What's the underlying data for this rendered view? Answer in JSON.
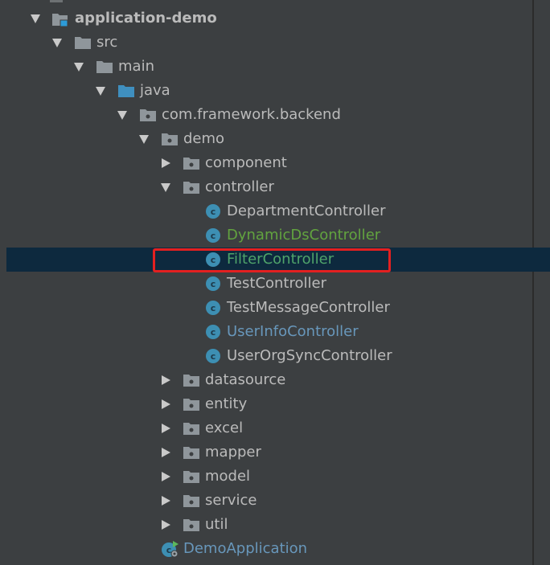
{
  "tree": {
    "root": {
      "label": "application-demo",
      "icon": "module-folder-icon",
      "expanded": true
    },
    "src": {
      "label": "src",
      "icon": "folder-icon",
      "expanded": true
    },
    "main": {
      "label": "main",
      "icon": "folder-icon",
      "expanded": true
    },
    "java": {
      "label": "java",
      "icon": "source-root-folder-icon",
      "expanded": true
    },
    "package": {
      "label": "com.framework.backend",
      "icon": "package-icon",
      "expanded": true
    },
    "demo": {
      "label": "demo",
      "icon": "package-icon",
      "expanded": true
    },
    "component": {
      "label": "component",
      "icon": "package-icon",
      "expanded": false
    },
    "controller": {
      "label": "controller",
      "icon": "package-icon",
      "expanded": true
    },
    "classes": [
      {
        "label": "DepartmentController",
        "color": "#bbbbbb"
      },
      {
        "label": "DynamicDsController",
        "color": "#62a33f"
      },
      {
        "label": "FilterController",
        "color": "#4fa36a",
        "selected": true
      },
      {
        "label": "TestController",
        "color": "#bbbbbb"
      },
      {
        "label": "TestMessageController",
        "color": "#bbbbbb"
      },
      {
        "label": "UserInfoController",
        "color": "#6897bb"
      },
      {
        "label": "UserOrgSyncController",
        "color": "#bbbbbb"
      }
    ],
    "packages_after": [
      {
        "label": "datasource"
      },
      {
        "label": "entity"
      },
      {
        "label": "excel"
      },
      {
        "label": "mapper"
      },
      {
        "label": "model"
      },
      {
        "label": "service"
      },
      {
        "label": "util"
      }
    ],
    "app_class": {
      "label": "DemoApplication",
      "color": "#6897bb",
      "icon": "spring-boot-class-icon"
    }
  },
  "colors": {
    "background": "#3c3f41",
    "selection": "#0d293e",
    "highlight_border": "#e32020",
    "class_icon": "#3d8fb3",
    "folder": "#8f969b",
    "source_folder": "#4a8bb4"
  }
}
